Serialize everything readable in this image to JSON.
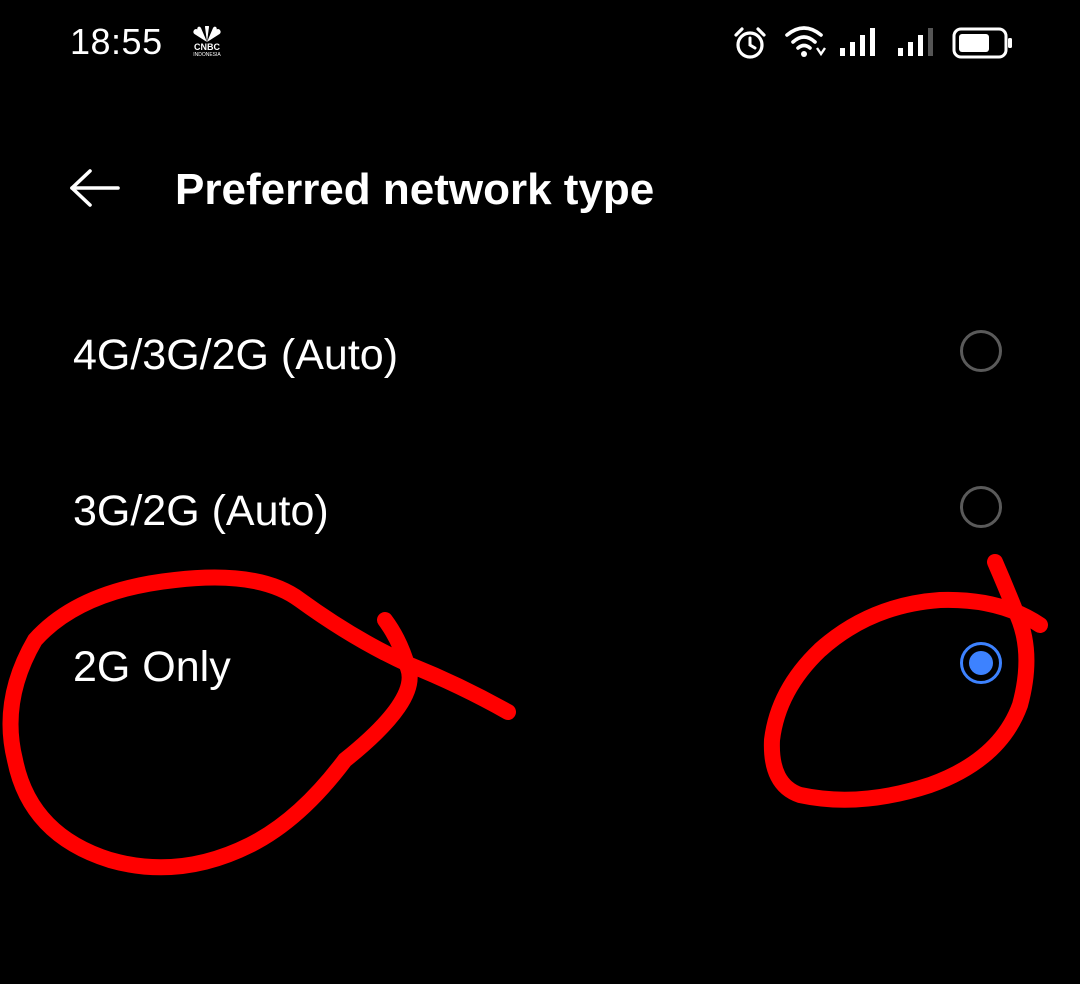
{
  "status_bar": {
    "time": "18:55",
    "logo_text": "CNBC",
    "logo_subtext": "INDONESIA",
    "icons": [
      "alarm-icon",
      "wifi-icon",
      "signal-icon",
      "signal-icon",
      "battery-icon"
    ]
  },
  "app_bar": {
    "back_icon": "arrow-left-icon",
    "title": "Preferred network type"
  },
  "options": [
    {
      "label": "4G/3G/2G (Auto)",
      "selected": false
    },
    {
      "label": "3G/2G (Auto)",
      "selected": false
    },
    {
      "label": "2G Only",
      "selected": true
    }
  ],
  "colors": {
    "background": "#000000",
    "text": "#ffffff",
    "accent": "#3d82ff",
    "radio_border": "#5a5a5a",
    "annotation": "#ff0000"
  }
}
